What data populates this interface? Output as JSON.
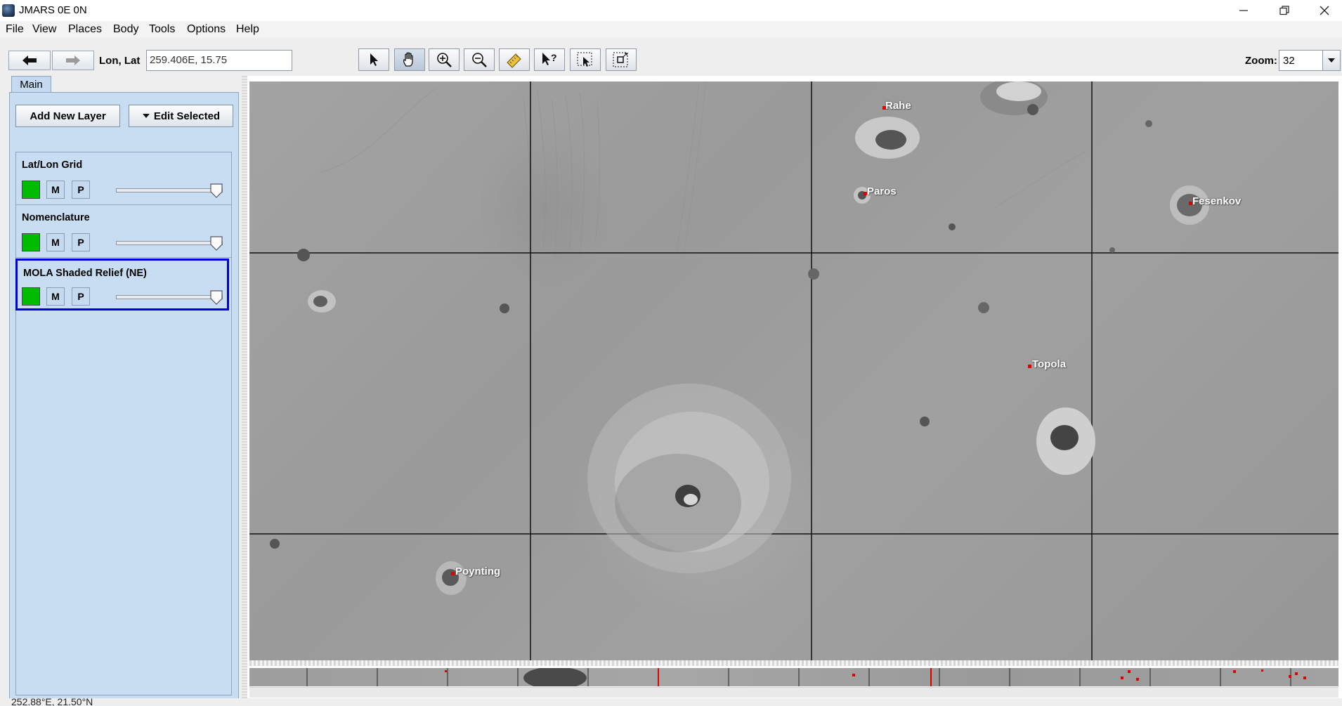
{
  "window": {
    "title": "JMARS 0E 0N",
    "minimize_icon": "minimize-icon",
    "maximize_icon": "restore-icon",
    "close_icon": "close-icon"
  },
  "menu": [
    "File",
    "View",
    "Places",
    "Body",
    "Tools",
    "Options",
    "Help"
  ],
  "toolbar": {
    "back_icon": "arrow-left-icon",
    "forward_icon": "arrow-right-icon",
    "lonlat_label": "Lon, Lat",
    "lonlat_value": "259.406E, 15.75",
    "tools": [
      "pointer-icon",
      "pan-hand-icon",
      "zoom-in-icon",
      "zoom-out-icon",
      "ruler-icon",
      "query-icon",
      "select-region-icon",
      "resize-icon"
    ],
    "zoom_label": "Zoom:",
    "zoom_value": "32"
  },
  "panel": {
    "tab": "Main",
    "add_layer": "Add New Layer",
    "edit_selected": "Edit Selected",
    "layers": [
      {
        "name": "Lat/Lon Grid",
        "m": "M",
        "p": "P",
        "opacity": 1.0,
        "visible": true,
        "selected": false
      },
      {
        "name": "Nomenclature",
        "m": "M",
        "p": "P",
        "opacity": 1.0,
        "visible": true,
        "selected": false
      },
      {
        "name": "MOLA Shaded Relief (NE)",
        "m": "M",
        "p": "P",
        "opacity": 1.0,
        "visible": true,
        "selected": true
      }
    ]
  },
  "map": {
    "places": [
      "Rahe",
      "Paros",
      "Fesenkov",
      "Topola",
      "Poynting"
    ],
    "accent_color": "#e10000",
    "grid_color": "#111111",
    "selection_color": "#0000d8"
  },
  "status": {
    "coords": "252.88°E, 21.50°N"
  }
}
